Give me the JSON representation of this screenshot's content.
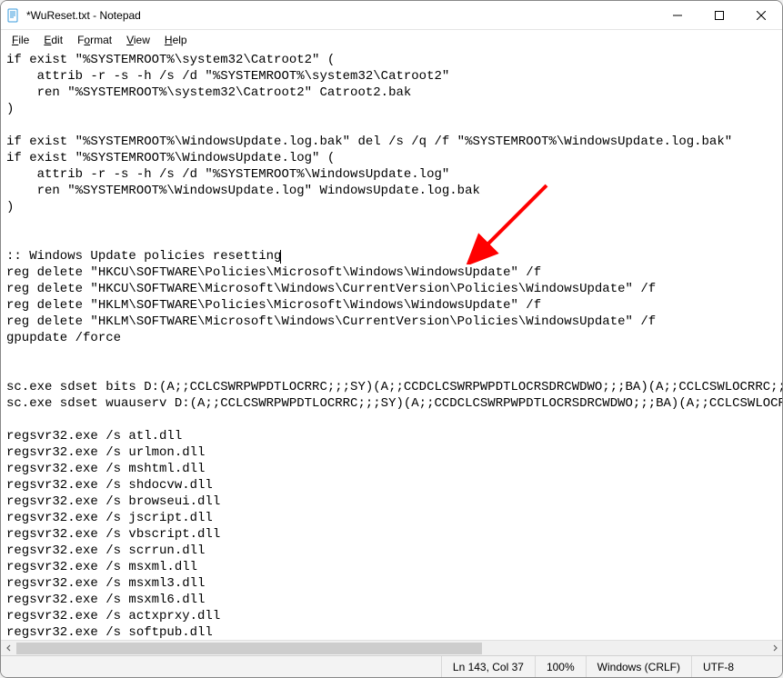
{
  "window": {
    "title": "*WuReset.txt - Notepad"
  },
  "menu": {
    "file": "File",
    "edit": "Edit",
    "format": "Format",
    "view": "View",
    "help": "Help"
  },
  "editor": {
    "lines": [
      "if exist \"%SYSTEMROOT%\\system32\\Catroot2\" (",
      "    attrib -r -s -h /s /d \"%SYSTEMROOT%\\system32\\Catroot2\"",
      "    ren \"%SYSTEMROOT%\\system32\\Catroot2\" Catroot2.bak",
      ")",
      "",
      "if exist \"%SYSTEMROOT%\\WindowsUpdate.log.bak\" del /s /q /f \"%SYSTEMROOT%\\WindowsUpdate.log.bak\"",
      "if exist \"%SYSTEMROOT%\\WindowsUpdate.log\" (",
      "    attrib -r -s -h /s /d \"%SYSTEMROOT%\\WindowsUpdate.log\"",
      "    ren \"%SYSTEMROOT%\\WindowsUpdate.log\" WindowsUpdate.log.bak",
      ")",
      "",
      "",
      ":: Windows Update policies resetting",
      "reg delete \"HKCU\\SOFTWARE\\Policies\\Microsoft\\Windows\\WindowsUpdate\" /f",
      "reg delete \"HKCU\\SOFTWARE\\Microsoft\\Windows\\CurrentVersion\\Policies\\WindowsUpdate\" /f",
      "reg delete \"HKLM\\SOFTWARE\\Policies\\Microsoft\\Windows\\WindowsUpdate\" /f",
      "reg delete \"HKLM\\SOFTWARE\\Microsoft\\Windows\\CurrentVersion\\Policies\\WindowsUpdate\" /f",
      "gpupdate /force",
      "",
      "",
      "sc.exe sdset bits D:(A;;CCLCSWRPWPDTLOCRRC;;;SY)(A;;CCDCLCSWRPWPDTLOCRSDRCWDWO;;;BA)(A;;CCLCSWLOCRRC;;;AU",
      "sc.exe sdset wuauserv D:(A;;CCLCSWRPWPDTLOCRRC;;;SY)(A;;CCDCLCSWRPWPDTLOCRSDRCWDWO;;;BA)(A;;CCLCSWLOCRRC",
      "",
      "regsvr32.exe /s atl.dll",
      "regsvr32.exe /s urlmon.dll",
      "regsvr32.exe /s mshtml.dll",
      "regsvr32.exe /s shdocvw.dll",
      "regsvr32.exe /s browseui.dll",
      "regsvr32.exe /s jscript.dll",
      "regsvr32.exe /s vbscript.dll",
      "regsvr32.exe /s scrrun.dll",
      "regsvr32.exe /s msxml.dll",
      "regsvr32.exe /s msxml3.dll",
      "regsvr32.exe /s msxml6.dll",
      "regsvr32.exe /s actxprxy.dll",
      "regsvr32.exe /s softpub.dll"
    ],
    "caret_line_index": 12
  },
  "status": {
    "pos": "Ln 143, Col 37",
    "zoom": "100%",
    "eol": "Windows (CRLF)",
    "encoding": "UTF-8"
  },
  "annotation": {
    "arrow_color": "#ff0000"
  }
}
